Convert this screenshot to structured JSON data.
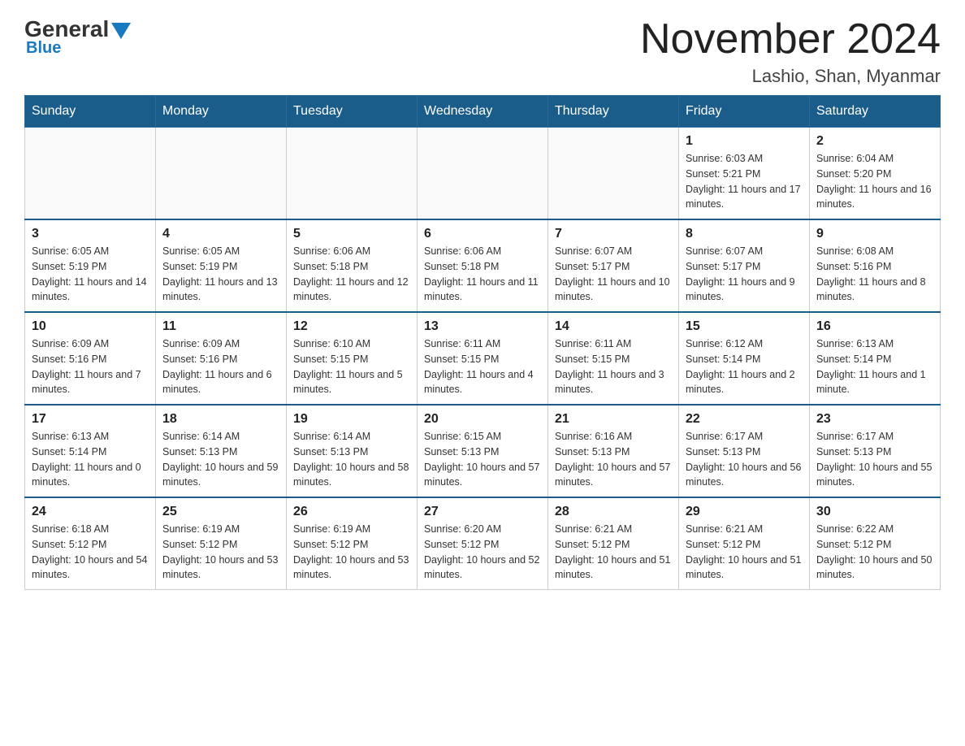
{
  "logo": {
    "general": "General",
    "blue": "Blue"
  },
  "header": {
    "title": "November 2024",
    "subtitle": "Lashio, Shan, Myanmar"
  },
  "days_of_week": [
    "Sunday",
    "Monday",
    "Tuesday",
    "Wednesday",
    "Thursday",
    "Friday",
    "Saturday"
  ],
  "weeks": [
    [
      {
        "day": "",
        "info": ""
      },
      {
        "day": "",
        "info": ""
      },
      {
        "day": "",
        "info": ""
      },
      {
        "day": "",
        "info": ""
      },
      {
        "day": "",
        "info": ""
      },
      {
        "day": "1",
        "info": "Sunrise: 6:03 AM\nSunset: 5:21 PM\nDaylight: 11 hours and 17 minutes."
      },
      {
        "day": "2",
        "info": "Sunrise: 6:04 AM\nSunset: 5:20 PM\nDaylight: 11 hours and 16 minutes."
      }
    ],
    [
      {
        "day": "3",
        "info": "Sunrise: 6:05 AM\nSunset: 5:19 PM\nDaylight: 11 hours and 14 minutes."
      },
      {
        "day": "4",
        "info": "Sunrise: 6:05 AM\nSunset: 5:19 PM\nDaylight: 11 hours and 13 minutes."
      },
      {
        "day": "5",
        "info": "Sunrise: 6:06 AM\nSunset: 5:18 PM\nDaylight: 11 hours and 12 minutes."
      },
      {
        "day": "6",
        "info": "Sunrise: 6:06 AM\nSunset: 5:18 PM\nDaylight: 11 hours and 11 minutes."
      },
      {
        "day": "7",
        "info": "Sunrise: 6:07 AM\nSunset: 5:17 PM\nDaylight: 11 hours and 10 minutes."
      },
      {
        "day": "8",
        "info": "Sunrise: 6:07 AM\nSunset: 5:17 PM\nDaylight: 11 hours and 9 minutes."
      },
      {
        "day": "9",
        "info": "Sunrise: 6:08 AM\nSunset: 5:16 PM\nDaylight: 11 hours and 8 minutes."
      }
    ],
    [
      {
        "day": "10",
        "info": "Sunrise: 6:09 AM\nSunset: 5:16 PM\nDaylight: 11 hours and 7 minutes."
      },
      {
        "day": "11",
        "info": "Sunrise: 6:09 AM\nSunset: 5:16 PM\nDaylight: 11 hours and 6 minutes."
      },
      {
        "day": "12",
        "info": "Sunrise: 6:10 AM\nSunset: 5:15 PM\nDaylight: 11 hours and 5 minutes."
      },
      {
        "day": "13",
        "info": "Sunrise: 6:11 AM\nSunset: 5:15 PM\nDaylight: 11 hours and 4 minutes."
      },
      {
        "day": "14",
        "info": "Sunrise: 6:11 AM\nSunset: 5:15 PM\nDaylight: 11 hours and 3 minutes."
      },
      {
        "day": "15",
        "info": "Sunrise: 6:12 AM\nSunset: 5:14 PM\nDaylight: 11 hours and 2 minutes."
      },
      {
        "day": "16",
        "info": "Sunrise: 6:13 AM\nSunset: 5:14 PM\nDaylight: 11 hours and 1 minute."
      }
    ],
    [
      {
        "day": "17",
        "info": "Sunrise: 6:13 AM\nSunset: 5:14 PM\nDaylight: 11 hours and 0 minutes."
      },
      {
        "day": "18",
        "info": "Sunrise: 6:14 AM\nSunset: 5:13 PM\nDaylight: 10 hours and 59 minutes."
      },
      {
        "day": "19",
        "info": "Sunrise: 6:14 AM\nSunset: 5:13 PM\nDaylight: 10 hours and 58 minutes."
      },
      {
        "day": "20",
        "info": "Sunrise: 6:15 AM\nSunset: 5:13 PM\nDaylight: 10 hours and 57 minutes."
      },
      {
        "day": "21",
        "info": "Sunrise: 6:16 AM\nSunset: 5:13 PM\nDaylight: 10 hours and 57 minutes."
      },
      {
        "day": "22",
        "info": "Sunrise: 6:17 AM\nSunset: 5:13 PM\nDaylight: 10 hours and 56 minutes."
      },
      {
        "day": "23",
        "info": "Sunrise: 6:17 AM\nSunset: 5:13 PM\nDaylight: 10 hours and 55 minutes."
      }
    ],
    [
      {
        "day": "24",
        "info": "Sunrise: 6:18 AM\nSunset: 5:12 PM\nDaylight: 10 hours and 54 minutes."
      },
      {
        "day": "25",
        "info": "Sunrise: 6:19 AM\nSunset: 5:12 PM\nDaylight: 10 hours and 53 minutes."
      },
      {
        "day": "26",
        "info": "Sunrise: 6:19 AM\nSunset: 5:12 PM\nDaylight: 10 hours and 53 minutes."
      },
      {
        "day": "27",
        "info": "Sunrise: 6:20 AM\nSunset: 5:12 PM\nDaylight: 10 hours and 52 minutes."
      },
      {
        "day": "28",
        "info": "Sunrise: 6:21 AM\nSunset: 5:12 PM\nDaylight: 10 hours and 51 minutes."
      },
      {
        "day": "29",
        "info": "Sunrise: 6:21 AM\nSunset: 5:12 PM\nDaylight: 10 hours and 51 minutes."
      },
      {
        "day": "30",
        "info": "Sunrise: 6:22 AM\nSunset: 5:12 PM\nDaylight: 10 hours and 50 minutes."
      }
    ]
  ]
}
